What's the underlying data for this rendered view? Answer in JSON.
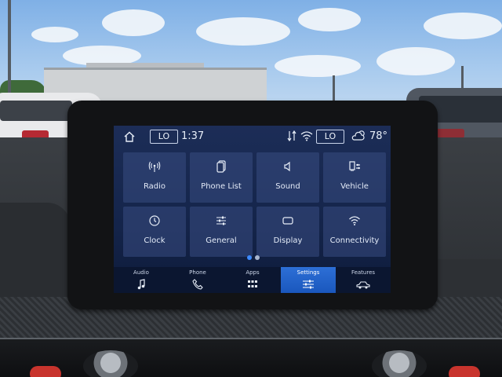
{
  "status_bar": {
    "home_icon": "home-icon",
    "left_temp_setting": "LO",
    "time": "1:37",
    "data_icon": "data-transfer-icon",
    "wifi_icon": "wifi-icon",
    "right_temp_setting": "LO",
    "weather_icon": "weather-cloud-icon",
    "outside_temp": "78°"
  },
  "settings_tiles": [
    {
      "label": "Radio",
      "icon": "radio-antenna-icon"
    },
    {
      "label": "Phone List",
      "icon": "phone-list-icon"
    },
    {
      "label": "Sound",
      "icon": "speaker-icon"
    },
    {
      "label": "Vehicle",
      "icon": "vehicle-settings-icon"
    },
    {
      "label": "Clock",
      "icon": "clock-icon"
    },
    {
      "label": "General",
      "icon": "sliders-icon"
    },
    {
      "label": "Display",
      "icon": "display-icon"
    },
    {
      "label": "Connectivity",
      "icon": "wireless-icon"
    }
  ],
  "page_indicator": {
    "pages": 2,
    "current": 1
  },
  "bottom_nav": [
    {
      "label": "Audio",
      "icon": "music-note-icon",
      "active": false
    },
    {
      "label": "Phone",
      "icon": "phone-icon",
      "active": false
    },
    {
      "label": "Apps",
      "icon": "apps-grid-icon",
      "active": false
    },
    {
      "label": "Settings",
      "icon": "settings-sliders-icon",
      "active": true
    },
    {
      "label": "Features",
      "icon": "car-icon",
      "active": false
    }
  ],
  "colors": {
    "screen_bg": "#14244a",
    "tile_bg": "#384c82",
    "active_tab": "#2d6fd6",
    "text": "#e6ecf8"
  }
}
